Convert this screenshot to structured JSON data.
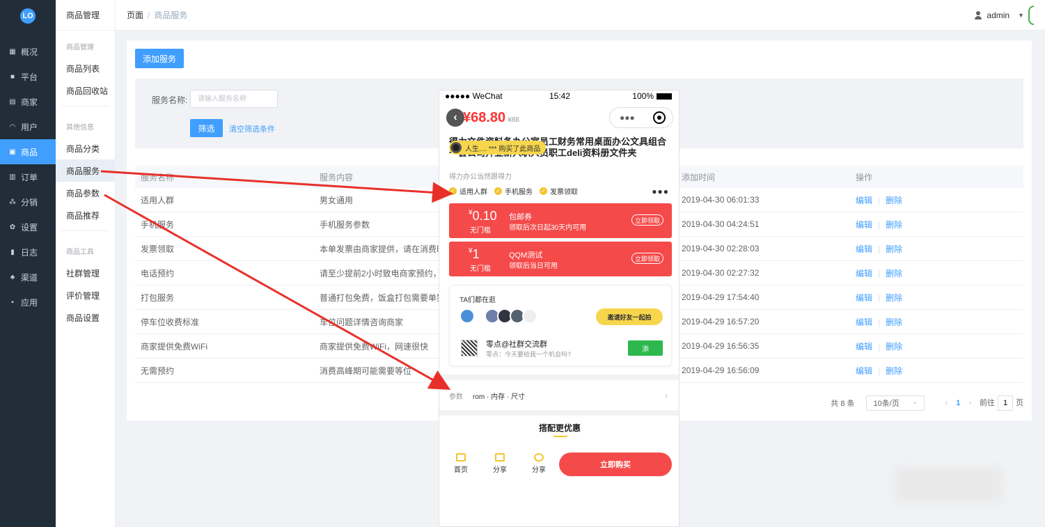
{
  "sidebar": {
    "logo": "LO",
    "items": [
      {
        "label": "概况",
        "icon": "dashboard-icon"
      },
      {
        "label": "平台",
        "icon": "monitor-icon"
      },
      {
        "label": "商家",
        "icon": "shop-icon"
      },
      {
        "label": "用户",
        "icon": "user-icon"
      },
      {
        "label": "商品",
        "icon": "goods-icon",
        "active": true
      },
      {
        "label": "订单",
        "icon": "order-icon"
      },
      {
        "label": "分销",
        "icon": "distribution-icon"
      },
      {
        "label": "设置",
        "icon": "gear-icon"
      },
      {
        "label": "日志",
        "icon": "log-icon"
      },
      {
        "label": "渠道",
        "icon": "channel-icon"
      },
      {
        "label": "应用",
        "icon": "apps-icon"
      }
    ]
  },
  "submenu": {
    "title": "商品管理",
    "group1": "商品管理",
    "list": "商品列表",
    "recycle": "商品回收站",
    "group2": "其他信息",
    "category": "商品分类",
    "service": "商品服务",
    "params": "商品参数",
    "recommend": "商品推荐",
    "group3": "商品工具",
    "community": "社群管理",
    "review": "评价管理",
    "settings": "商品设置"
  },
  "header": {
    "crumb_root": "页面",
    "crumb_sep": "/",
    "crumb_current": "商品服务",
    "user": "admin"
  },
  "toolbar": {
    "add_label": "添加服务"
  },
  "filter": {
    "label": "服务名称:",
    "placeholder": "请输入服务名称",
    "button": "筛选",
    "clear": "清空筛选条件"
  },
  "table": {
    "headers": [
      "服务名称",
      "服务内容",
      "添加时间",
      "操作"
    ],
    "edit": "编辑",
    "delete": "删除",
    "rows": [
      {
        "name": "适用人群",
        "content": "男女通用",
        "time": "2019-04-30 06:01:33"
      },
      {
        "name": "手机服务",
        "content": "手机服务参数",
        "time": "2019-04-30 04:24:51"
      },
      {
        "name": "发票领取",
        "content": "本单发票由商家提供，请在消费时向",
        "time": "2019-04-30 02:28:03"
      },
      {
        "name": "电话预约",
        "content": "请至少提前2小时致电商家预约，预",
        "time": "2019-04-30 02:27:32"
      },
      {
        "name": "打包服务",
        "content": "普通打包免费，饭盒打包需要单独收",
        "time": "2019-04-29 17:54:40"
      },
      {
        "name": "停车位收费标准",
        "content": "车位问题详情咨询商家",
        "time": "2019-04-29 16:57:20"
      },
      {
        "name": "商家提供免费WiFi",
        "content": "商家提供免费WiFi，网速很快",
        "time": "2019-04-29 16:56:35"
      },
      {
        "name": "无需预约",
        "content": "消费高峰期可能需要等位",
        "time": "2019-04-29 16:56:09"
      }
    ]
  },
  "pager": {
    "total": "共 8 条",
    "size": "10条/页",
    "prev": "‹",
    "page": "1",
    "next": "›",
    "goto_pre": "前往",
    "goto_val": "1",
    "goto_post": "页"
  },
  "phone": {
    "carrier": "●●●●● WeChat",
    "time": "15:42",
    "battery": "100%",
    "price": "68.80",
    "orig_price": "¥88",
    "capsule": "●●●",
    "buyer_tag": "人生.... *** 购买了此商品",
    "title": "得力文件资料备办公室员工财务常用桌面办公文具组合一套公司开业新入职人员职工deli资料册文件夹",
    "subtitle": "得力办公当然跟得力",
    "services": [
      "适用人群",
      "手机服务",
      "发票领取"
    ],
    "more": "●●●",
    "coupons": [
      {
        "amount": "0.10",
        "cond": "无门槛",
        "name": "包邮券",
        "desc": "领取后次日起30天内可用",
        "get": "立即领取"
      },
      {
        "amount": "1",
        "cond": "无门槛",
        "name": "QQM测试",
        "desc": "领取后当日可用",
        "get": "立即领取"
      }
    ],
    "group_title": "TA们都在逛",
    "invite": "邀请好友一起拍",
    "group_name": "零点@社群交流群",
    "group_msg": "零点：今天要给我一个机会吗?",
    "group_add": "添",
    "params_label": "参数",
    "params_value": "rom · 内存 · 尺寸",
    "params_chev": "›",
    "combo": "搭配更优惠",
    "tab_home": "首页",
    "tab_share1": "分享",
    "tab_share2": "分享",
    "buy": "立即购买"
  },
  "colors": {
    "primary": "#409eff",
    "sidebar_bg": "#222d3a",
    "phone_red": "#f54a4a",
    "phone_yellow": "#f7d64d",
    "arrow_red": "#e8302a"
  }
}
